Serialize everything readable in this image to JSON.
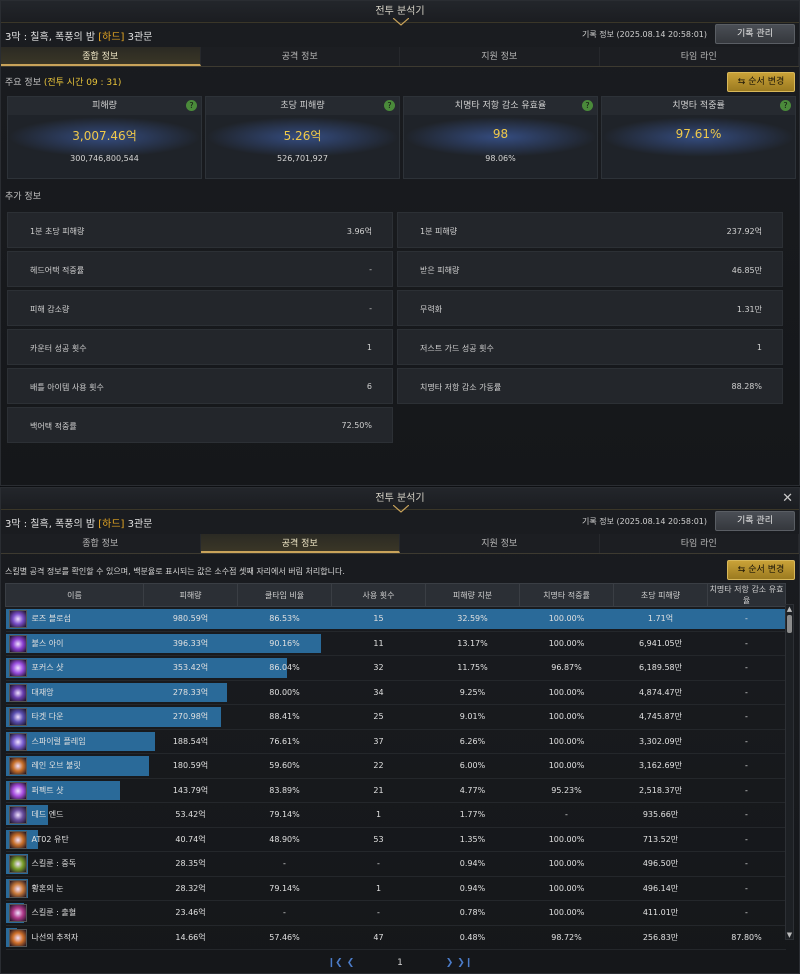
{
  "colors": {
    "accent_gold": "#e9a923",
    "bar_blue": "#2a6a99",
    "help_green": "#4a8a3a"
  },
  "window": {
    "title": "전투 분석기",
    "close": "✕"
  },
  "header": {
    "stage": "3막 : 칠흑, 폭풍의 밤",
    "difficulty": "[하드]",
    "gate": "3관문",
    "record_info": "기록 정보 (2025.08.14 20:58:01)",
    "manage_label": "기록 관리"
  },
  "tabs": [
    {
      "label": "종합 정보"
    },
    {
      "label": "공격 정보"
    },
    {
      "label": "지원 정보"
    },
    {
      "label": "타임 라인"
    }
  ],
  "overview": {
    "main_label": "주요 정보",
    "battle_time": "(전투 시간 09 : 31)",
    "order_label": "순서 변경",
    "help_icon": "?",
    "stats": [
      {
        "title": "피해량",
        "value": "3,007.46억",
        "sub": "300,746,800,544"
      },
      {
        "title": "초당 피해량",
        "value": "5.26억",
        "sub": "526,701,927"
      },
      {
        "title": "치명타 저항 감소 유효율",
        "value": "98",
        "sub": "98.06%"
      },
      {
        "title": "치명타 적중률",
        "value": "97.61%",
        "sub": ""
      }
    ],
    "extra_label": "추가 정보",
    "extra": [
      {
        "label": "1분 초당 피해량",
        "value": "3.96억"
      },
      {
        "label": "1분 피해량",
        "value": "237.92억"
      },
      {
        "label": "헤드어택 적중률",
        "value": "-"
      },
      {
        "label": "받은 피해량",
        "value": "46.85만"
      },
      {
        "label": "피해 감소량",
        "value": "-"
      },
      {
        "label": "무력화",
        "value": "1.31만"
      },
      {
        "label": "카운터 성공 횟수",
        "value": "1"
      },
      {
        "label": "저스트 가드 성공 횟수",
        "value": "1"
      },
      {
        "label": "배틀 아이템 사용 횟수",
        "value": "6"
      },
      {
        "label": "치명타 저항 감소 가동률",
        "value": "88.28%"
      },
      {
        "label": "백어택 적중률",
        "value": "72.50%"
      }
    ]
  },
  "attack": {
    "description": "스킬별 공격 정보를 확인할 수 있으며, 백분율로 표시되는 값은 소수점 셋째 자리에서 버림 처리합니다.",
    "order_label": "순서 변경",
    "columns": [
      "이름",
      "피해량",
      "쿨타임 비율",
      "사용 횟수",
      "피해량 지분",
      "치명타 적중률",
      "초당 피해량",
      "치명타 저항 감소 유효율"
    ],
    "rows": [
      {
        "name": "로즈 블로섬",
        "damage": "980.59억",
        "cd": "86.53%",
        "uses": "15",
        "share": "32.59%",
        "crit": "100.00%",
        "dps": "1.71억",
        "crr": "-",
        "icon_color": "#7a4fc9",
        "share_num": 32.59
      },
      {
        "name": "불스 아이",
        "damage": "396.33억",
        "cd": "90.16%",
        "uses": "11",
        "share": "13.17%",
        "crit": "100.00%",
        "dps": "6,941.05만",
        "crr": "-",
        "icon_color": "#8a3fd1",
        "share_num": 13.17
      },
      {
        "name": "포커스 샷",
        "damage": "353.42억",
        "cd": "86.04%",
        "uses": "32",
        "share": "11.75%",
        "crit": "96.87%",
        "dps": "6,189.58만",
        "crr": "-",
        "icon_color": "#9a4fe0",
        "share_num": 11.75
      },
      {
        "name": "대재앙",
        "damage": "278.33억",
        "cd": "80.00%",
        "uses": "34",
        "share": "9.25%",
        "crit": "100.00%",
        "dps": "4,874.47만",
        "crr": "-",
        "icon_color": "#6a3fb0",
        "share_num": 9.25
      },
      {
        "name": "타겟 다운",
        "damage": "270.98억",
        "cd": "88.41%",
        "uses": "25",
        "share": "9.01%",
        "crit": "100.00%",
        "dps": "4,745.87만",
        "crr": "-",
        "icon_color": "#5a4fb0",
        "share_num": 9.01
      },
      {
        "name": "스파이럴 플레임",
        "damage": "188.54억",
        "cd": "76.61%",
        "uses": "37",
        "share": "6.26%",
        "crit": "100.00%",
        "dps": "3,302.09만",
        "crr": "-",
        "icon_color": "#7a5fd0",
        "share_num": 6.26
      },
      {
        "name": "레인 오브 불릿",
        "damage": "180.59억",
        "cd": "59.60%",
        "uses": "22",
        "share": "6.00%",
        "crit": "100.00%",
        "dps": "3,162.69만",
        "crr": "-",
        "icon_color": "#c8702a",
        "share_num": 6.0
      },
      {
        "name": "퍼펙트 샷",
        "damage": "143.79억",
        "cd": "83.89%",
        "uses": "21",
        "share": "4.77%",
        "crit": "95.23%",
        "dps": "2,518.37만",
        "crr": "-",
        "icon_color": "#a84fe0",
        "share_num": 4.77
      },
      {
        "name": "데드 엔드",
        "damage": "53.42억",
        "cd": "79.14%",
        "uses": "1",
        "share": "1.77%",
        "crit": "-",
        "dps": "935.66만",
        "crr": "-",
        "icon_color": "#6a4fa0",
        "share_num": 1.77
      },
      {
        "name": "AT02 유탄",
        "damage": "40.74억",
        "cd": "48.90%",
        "uses": "53",
        "share": "1.35%",
        "crit": "100.00%",
        "dps": "713.52만",
        "crr": "-",
        "icon_color": "#c8702a",
        "share_num": 1.35
      },
      {
        "name": "스킬룬 : 중독",
        "damage": "28.35억",
        "cd": "-",
        "uses": "-",
        "share": "0.94%",
        "crit": "100.00%",
        "dps": "496.50만",
        "crr": "-",
        "icon_color": "#7aa02a",
        "share_num": 0.94
      },
      {
        "name": "황혼의 눈",
        "damage": "28.32억",
        "cd": "79.14%",
        "uses": "1",
        "share": "0.94%",
        "crit": "100.00%",
        "dps": "496.14만",
        "crr": "-",
        "icon_color": "#c87a3a",
        "share_num": 0.94
      },
      {
        "name": "스킬룬 : 출혈",
        "damage": "23.46억",
        "cd": "-",
        "uses": "-",
        "share": "0.78%",
        "crit": "100.00%",
        "dps": "411.01만",
        "crr": "-",
        "icon_color": "#b03a8a",
        "share_num": 0.78
      },
      {
        "name": "나선의 추적자",
        "damage": "14.66억",
        "cd": "57.46%",
        "uses": "47",
        "share": "0.48%",
        "crit": "98.72%",
        "dps": "256.83만",
        "crr": "87.80%",
        "icon_color": "#d0702a",
        "share_num": 0.48
      }
    ],
    "pager": {
      "first": "❙❮",
      "prev": "❮",
      "page": "1",
      "next": "❯",
      "last": "❯❙"
    }
  }
}
